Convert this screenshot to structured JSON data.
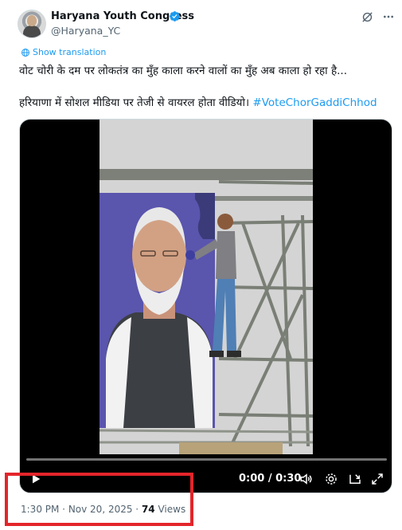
{
  "post": {
    "display_name": "Haryana Youth Congress",
    "handle": "@Haryana_YC",
    "show_translation_label": "Show translation",
    "text_line_1": "वोट चोरी के दम पर लोकतंत्र का मुँह काला करने वालों का मुँह अब काला हो रहा है...",
    "text_line_2": "हरियाणा में सोशल मीडिया पर तेजी से वायरल होता वीडियो।",
    "hashtag": "#VoteChorGaddiChhod"
  },
  "video": {
    "time_label": "0:00 / 0:30",
    "progress_fraction": 0.0
  },
  "meta": {
    "time": "1:30 PM",
    "date": "Nov 20, 2025",
    "views_count": "74",
    "views_label": "Views"
  },
  "colors": {
    "link": "#1d9bf0",
    "verified": "#1d9bf0",
    "highlight": "#e3252a"
  },
  "icons": {
    "verified": "verified-badge-icon",
    "grok": "grok-icon",
    "more": "more-options-icon",
    "translate": "translate-icon",
    "play": "play-icon",
    "volume": "volume-icon",
    "settings": "settings-icon",
    "pip": "picture-in-picture-icon",
    "fullscreen": "fullscreen-icon"
  }
}
